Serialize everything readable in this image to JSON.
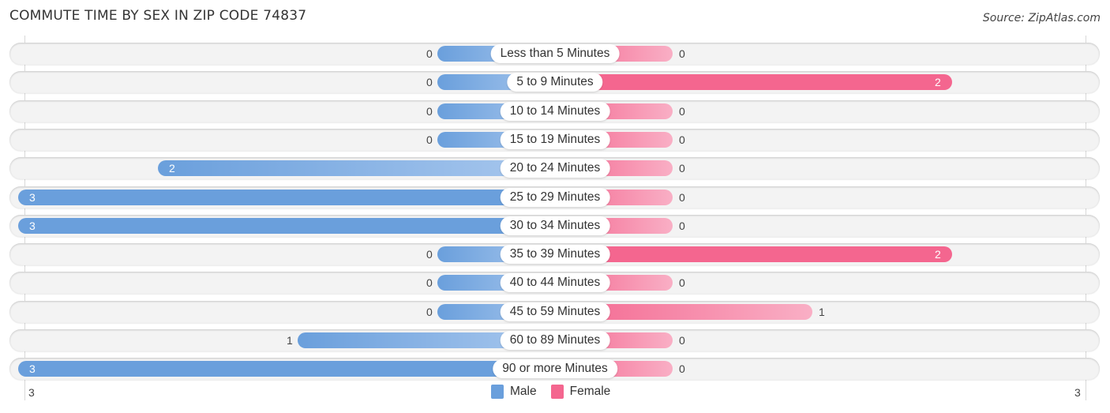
{
  "chart_data": {
    "type": "bar",
    "orientation": "horizontal-diverging",
    "title": "COMMUTE TIME BY SEX IN ZIP CODE 74837",
    "source": "Source: ZipAtlas.com",
    "categories": [
      "Less than 5 Minutes",
      "5 to 9 Minutes",
      "10 to 14 Minutes",
      "15 to 19 Minutes",
      "20 to 24 Minutes",
      "25 to 29 Minutes",
      "30 to 34 Minutes",
      "35 to 39 Minutes",
      "40 to 44 Minutes",
      "45 to 59 Minutes",
      "60 to 89 Minutes",
      "90 or more Minutes"
    ],
    "series": [
      {
        "name": "Male",
        "color": "#6a9fdc",
        "values": [
          0,
          0,
          0,
          0,
          2,
          3,
          3,
          0,
          0,
          0,
          1,
          3
        ]
      },
      {
        "name": "Female",
        "color": "#f4668f",
        "values": [
          0,
          2,
          0,
          0,
          0,
          0,
          0,
          2,
          0,
          1,
          0,
          0
        ]
      }
    ],
    "axis": {
      "left_label": "3",
      "right_label": "3",
      "max": 3
    },
    "legend": {
      "position": "bottom-center",
      "items": [
        "Male",
        "Female"
      ]
    }
  }
}
